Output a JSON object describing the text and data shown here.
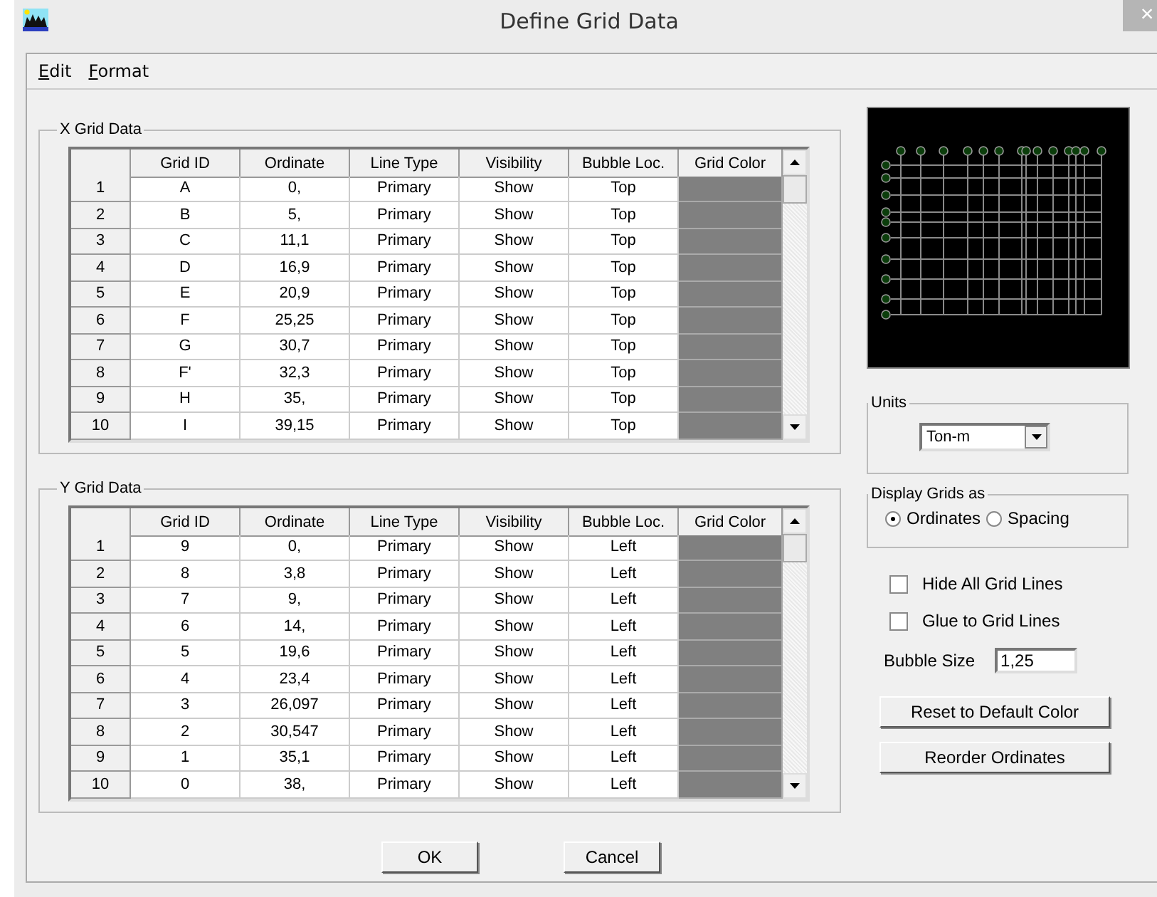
{
  "window": {
    "title": "Define Grid Data",
    "close": "×"
  },
  "menu": [
    {
      "label": "Edit"
    },
    {
      "label": "Format"
    }
  ],
  "x_grid": {
    "title": "X Grid Data",
    "columns": [
      "Grid ID",
      "Ordinate",
      "Line Type",
      "Visibility",
      "Bubble Loc.",
      "Grid Color"
    ],
    "rows": [
      {
        "num": "1",
        "grid_id": "A",
        "ordinate": "0,",
        "line_type": "Primary",
        "visibility": "Show",
        "bubble_loc": "Top",
        "color": "#808080"
      },
      {
        "num": "2",
        "grid_id": "B",
        "ordinate": "5,",
        "line_type": "Primary",
        "visibility": "Show",
        "bubble_loc": "Top",
        "color": "#808080"
      },
      {
        "num": "3",
        "grid_id": "C",
        "ordinate": "11,1",
        "line_type": "Primary",
        "visibility": "Show",
        "bubble_loc": "Top",
        "color": "#808080"
      },
      {
        "num": "4",
        "grid_id": "D",
        "ordinate": "16,9",
        "line_type": "Primary",
        "visibility": "Show",
        "bubble_loc": "Top",
        "color": "#808080"
      },
      {
        "num": "5",
        "grid_id": "E",
        "ordinate": "20,9",
        "line_type": "Primary",
        "visibility": "Show",
        "bubble_loc": "Top",
        "color": "#808080"
      },
      {
        "num": "6",
        "grid_id": "F",
        "ordinate": "25,25",
        "line_type": "Primary",
        "visibility": "Show",
        "bubble_loc": "Top",
        "color": "#808080"
      },
      {
        "num": "7",
        "grid_id": "G",
        "ordinate": "30,7",
        "line_type": "Primary",
        "visibility": "Show",
        "bubble_loc": "Top",
        "color": "#808080"
      },
      {
        "num": "8",
        "grid_id": "F'",
        "ordinate": "32,3",
        "line_type": "Primary",
        "visibility": "Show",
        "bubble_loc": "Top",
        "color": "#808080"
      },
      {
        "num": "9",
        "grid_id": "H",
        "ordinate": "35,",
        "line_type": "Primary",
        "visibility": "Show",
        "bubble_loc": "Top",
        "color": "#808080"
      },
      {
        "num": "10",
        "grid_id": "I",
        "ordinate": "39,15",
        "line_type": "Primary",
        "visibility": "Show",
        "bubble_loc": "Top",
        "color": "#808080"
      }
    ]
  },
  "y_grid": {
    "title": "Y Grid Data",
    "columns": [
      "Grid ID",
      "Ordinate",
      "Line Type",
      "Visibility",
      "Bubble Loc.",
      "Grid Color"
    ],
    "rows": [
      {
        "num": "1",
        "grid_id": "9",
        "ordinate": "0,",
        "line_type": "Primary",
        "visibility": "Show",
        "bubble_loc": "Left",
        "color": "#808080"
      },
      {
        "num": "2",
        "grid_id": "8",
        "ordinate": "3,8",
        "line_type": "Primary",
        "visibility": "Show",
        "bubble_loc": "Left",
        "color": "#808080"
      },
      {
        "num": "3",
        "grid_id": "7",
        "ordinate": "9,",
        "line_type": "Primary",
        "visibility": "Show",
        "bubble_loc": "Left",
        "color": "#808080"
      },
      {
        "num": "4",
        "grid_id": "6",
        "ordinate": "14,",
        "line_type": "Primary",
        "visibility": "Show",
        "bubble_loc": "Left",
        "color": "#808080"
      },
      {
        "num": "5",
        "grid_id": "5",
        "ordinate": "19,6",
        "line_type": "Primary",
        "visibility": "Show",
        "bubble_loc": "Left",
        "color": "#808080"
      },
      {
        "num": "6",
        "grid_id": "4",
        "ordinate": "23,4",
        "line_type": "Primary",
        "visibility": "Show",
        "bubble_loc": "Left",
        "color": "#808080"
      },
      {
        "num": "7",
        "grid_id": "3",
        "ordinate": "26,097",
        "line_type": "Primary",
        "visibility": "Show",
        "bubble_loc": "Left",
        "color": "#808080"
      },
      {
        "num": "8",
        "grid_id": "2",
        "ordinate": "30,547",
        "line_type": "Primary",
        "visibility": "Show",
        "bubble_loc": "Left",
        "color": "#808080"
      },
      {
        "num": "9",
        "grid_id": "1",
        "ordinate": "35,1",
        "line_type": "Primary",
        "visibility": "Show",
        "bubble_loc": "Left",
        "color": "#808080"
      },
      {
        "num": "10",
        "grid_id": "0",
        "ordinate": "38,",
        "line_type": "Primary",
        "visibility": "Show",
        "bubble_loc": "Left",
        "color": "#808080"
      }
    ]
  },
  "units": {
    "label": "Units",
    "value": "Ton-m"
  },
  "display_grids": {
    "label": "Display Grids as",
    "options": [
      {
        "label": "Ordinates",
        "selected": true
      },
      {
        "label": "Spacing",
        "selected": false
      }
    ]
  },
  "checkboxes": [
    {
      "label": "Hide All Grid Lines",
      "checked": false
    },
    {
      "label": "Glue to Grid Lines",
      "checked": false
    }
  ],
  "bubble_size": {
    "label": "Bubble Size",
    "value": "1,25"
  },
  "side_buttons": [
    "Reset to Default Color",
    "Reorder Ordinates"
  ],
  "dialog_buttons": [
    "OK",
    "Cancel"
  ]
}
